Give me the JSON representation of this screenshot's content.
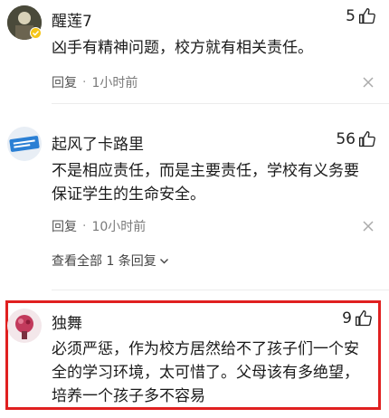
{
  "comments": [
    {
      "name": "醒莲7",
      "likes": "5",
      "text": "凶手有精神问题，校方就有相关责任。",
      "reply_label": "回复",
      "time": "1小时前"
    },
    {
      "name": "起风了卡路里",
      "likes": "56",
      "text": "不是相应责任，而是主要责任，学校有义务要保证学生的生命安全。",
      "reply_label": "回复",
      "time": "10小时前",
      "view_all": "查看全部 1 条回复"
    },
    {
      "name": "独舞",
      "likes": "9",
      "text": "必须严惩，作为校方居然给不了孩子们一个安全的学习环境，太可惜了。父母该有多绝望，培养一个孩子多不容易"
    }
  ],
  "colors": {
    "highlight": "#e02020",
    "meta": "#7a7a7a",
    "divider": "#ececec"
  },
  "icons": [
    "thumbs-up-icon",
    "close-icon",
    "chevron-down-icon",
    "verified-badge-icon"
  ]
}
